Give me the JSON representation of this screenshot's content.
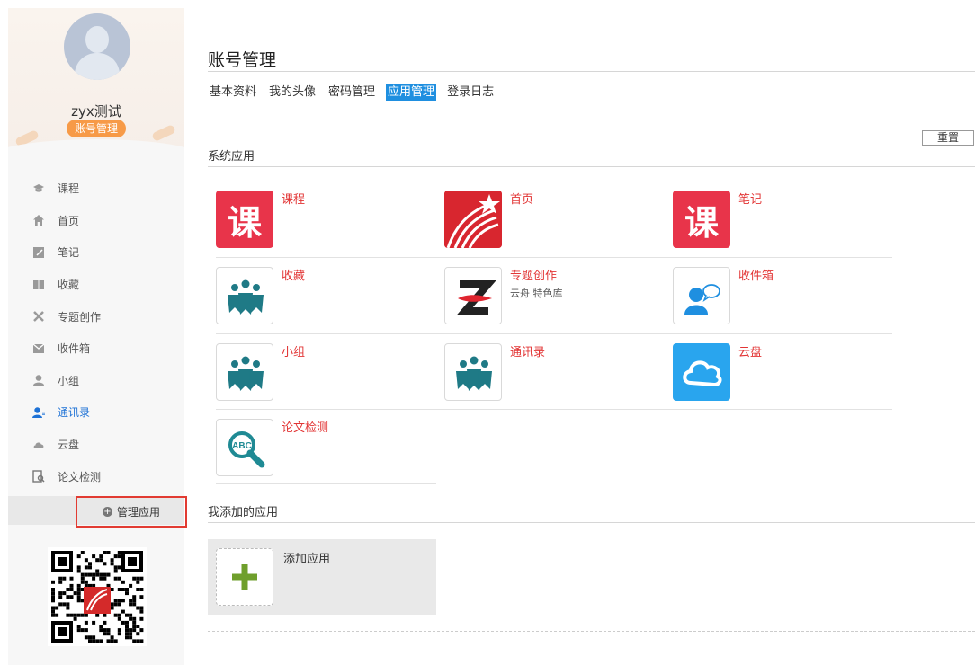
{
  "sidebar": {
    "username": "zyx测试",
    "badge": "账号管理",
    "items": [
      {
        "label": "课程",
        "icon": "graduation-cap-icon"
      },
      {
        "label": "首页",
        "icon": "home-icon"
      },
      {
        "label": "笔记",
        "icon": "note-icon"
      },
      {
        "label": "收藏",
        "icon": "book-icon"
      },
      {
        "label": "专题创作",
        "icon": "tools-icon"
      },
      {
        "label": "收件箱",
        "icon": "inbox-icon"
      },
      {
        "label": "小组",
        "icon": "user-icon"
      },
      {
        "label": "通讯录",
        "icon": "contacts-icon"
      },
      {
        "label": "云盘",
        "icon": "cloud-icon"
      },
      {
        "label": "论文检测",
        "icon": "document-search-icon"
      }
    ],
    "active_item": "通讯录",
    "manage_label": "管理应用"
  },
  "header": {
    "title": "账号管理",
    "tabs": [
      {
        "label": "基本资料"
      },
      {
        "label": "我的头像"
      },
      {
        "label": "密码管理"
      },
      {
        "label": "应用管理"
      },
      {
        "label": "登录日志"
      }
    ],
    "active_tab": "应用管理",
    "reset_label": "重置"
  },
  "system_apps": {
    "title": "系统应用",
    "apps": [
      {
        "name": "课程",
        "icon": "course-icon"
      },
      {
        "name": "首页",
        "icon": "xuexitong-logo-icon"
      },
      {
        "name": "笔记",
        "icon": "course-icon"
      },
      {
        "name": "收藏",
        "icon": "people-group-icon"
      },
      {
        "name": "专题创作",
        "sub": "云舟 特色库",
        "icon": "zhuanti-logo-icon"
      },
      {
        "name": "收件箱",
        "icon": "chat-user-icon"
      },
      {
        "name": "小组",
        "icon": "people-group-icon"
      },
      {
        "name": "通讯录",
        "icon": "people-group-icon"
      },
      {
        "name": "云盘",
        "icon": "cloud-icon"
      },
      {
        "name": "论文检测",
        "icon": "abc-search-icon"
      }
    ]
  },
  "my_apps": {
    "title": "我添加的应用",
    "add_label": "添加应用"
  },
  "icon_glyphs": {
    "course": "课"
  },
  "colors": {
    "accent_blue": "#1f8fe0",
    "app_name_red": "#e23535",
    "badge_orange": "#f79a47",
    "highlight_red": "#e23b32",
    "plus_green": "#6f9f2c",
    "cloud_blue": "#29a5ee",
    "group_teal": "#1f7a86"
  }
}
